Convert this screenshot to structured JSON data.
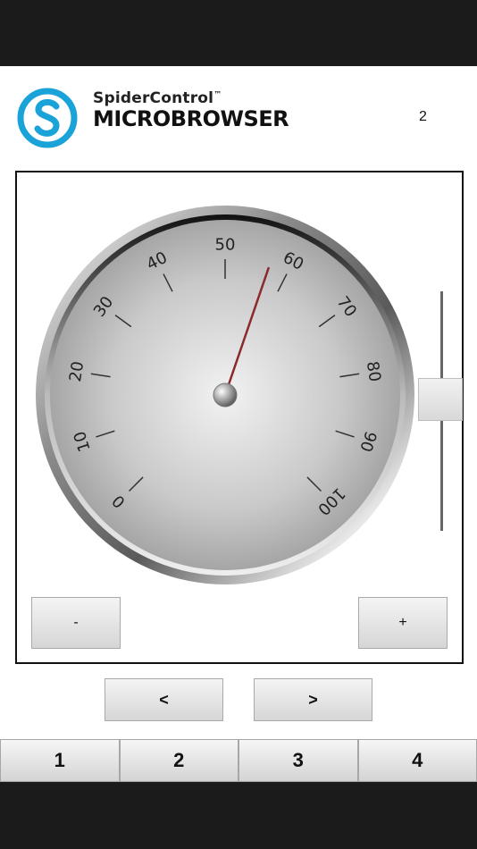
{
  "header": {
    "brand_top": "SpiderControl",
    "brand_tm": "™",
    "brand_bottom": "MICROBROWSER",
    "page_number": "2",
    "logo_icon": "spidercontrol-s-logo-icon",
    "logo_color": "#1aa3d8"
  },
  "gauge": {
    "ticks": [
      "0",
      "10",
      "20",
      "30",
      "40",
      "50",
      "60",
      "70",
      "80",
      "90",
      "100"
    ],
    "min": 0,
    "max": 100,
    "value": 57,
    "needle_color": "#8b2a2a"
  },
  "slider": {
    "level": 0.55
  },
  "controls": {
    "minus_label": "-",
    "plus_label": "+",
    "prev_label": "<",
    "next_label": ">"
  },
  "tabs": [
    {
      "label": "1"
    },
    {
      "label": "2"
    },
    {
      "label": "3"
    },
    {
      "label": "4"
    }
  ]
}
